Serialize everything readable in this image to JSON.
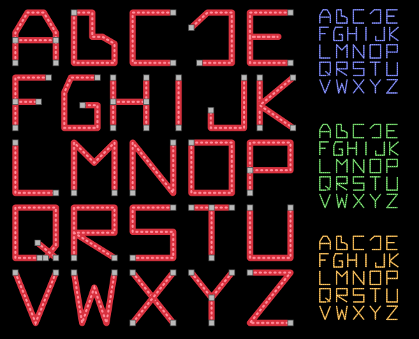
{
  "sets": [
    {
      "id": "red",
      "color": "#d8323f",
      "bulb": "#ff8a98"
    },
    {
      "id": "blue",
      "color": "#4a55b8",
      "bulb": "#aab2ff"
    },
    {
      "id": "green",
      "color": "#3f9b3a",
      "bulb": "#a9ef9f"
    },
    {
      "id": "orange",
      "color": "#c38a2c",
      "bulb": "#ffd98e"
    }
  ],
  "rows": [
    [
      "A",
      "B",
      "C",
      "D",
      "E"
    ],
    [
      "F",
      "G",
      "H",
      "I",
      "J",
      "K"
    ],
    [
      "L",
      "M",
      "N",
      "O",
      "P"
    ],
    [
      "Q",
      "R",
      "S",
      "T",
      "U"
    ],
    [
      "V",
      "W",
      "X",
      "Y",
      "Z"
    ]
  ]
}
